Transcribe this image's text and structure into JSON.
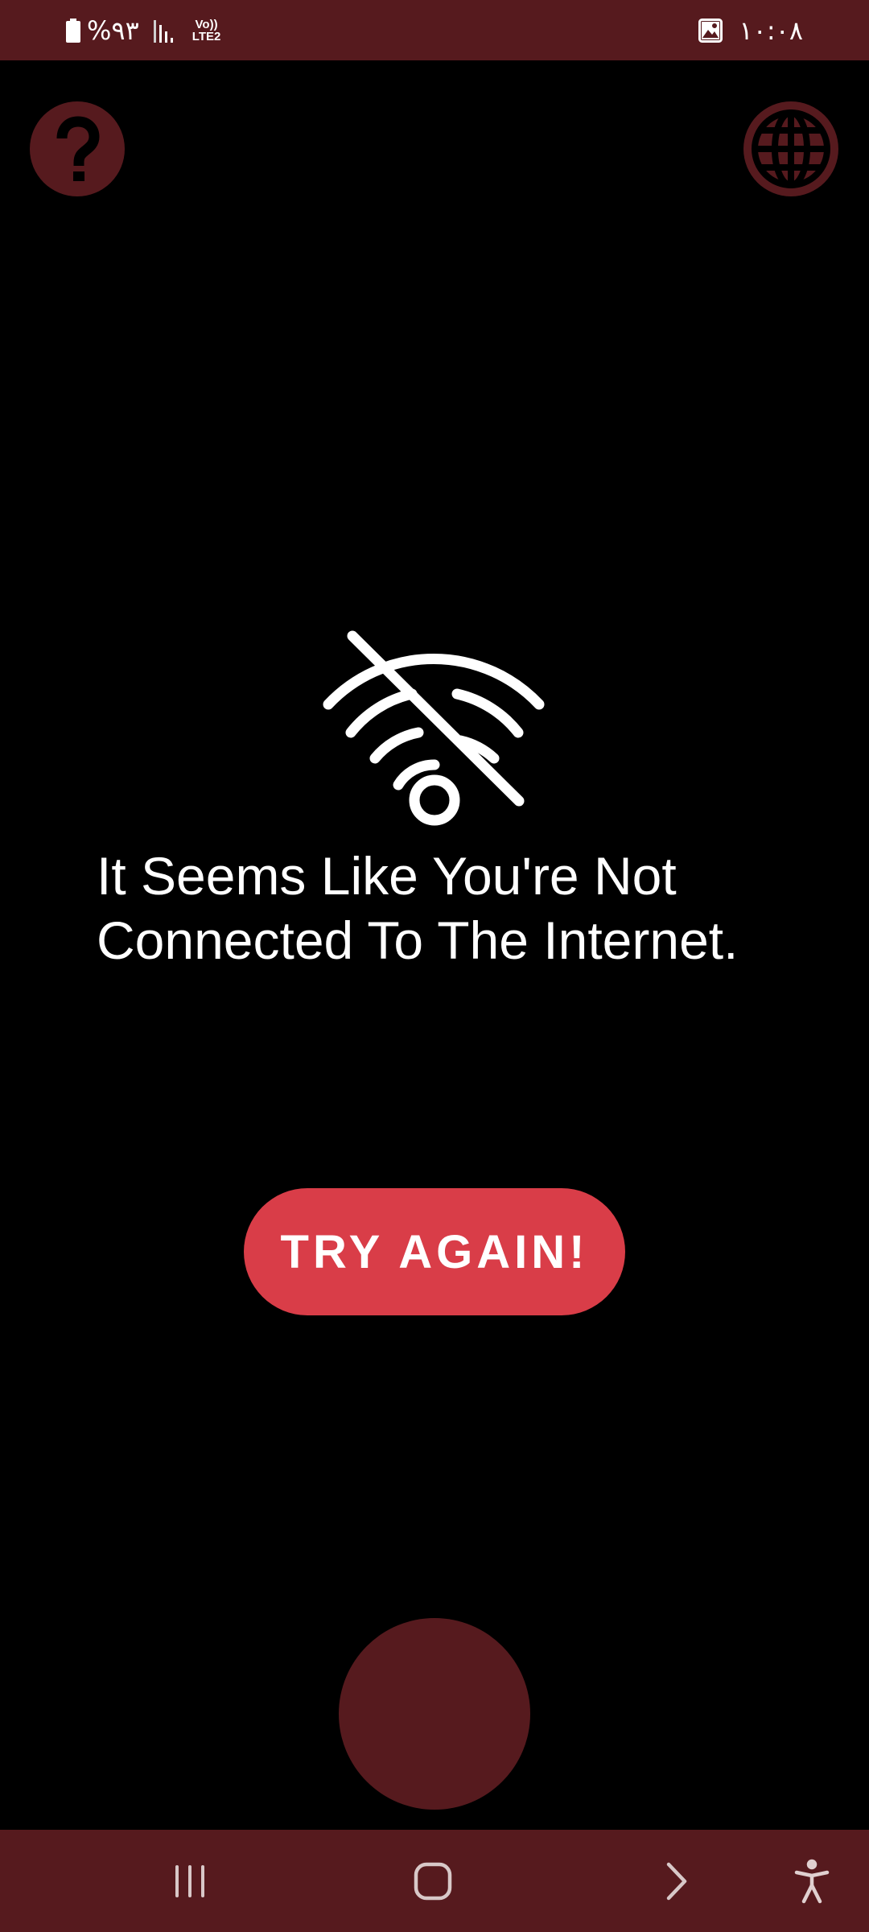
{
  "status_bar": {
    "battery_text": "%٩٣",
    "network_top": "Vo))",
    "network_bottom": "LTE2",
    "time": "١٠:٠٨"
  },
  "icons": {
    "help": "question-mark-icon",
    "language": "globe-icon",
    "no_connection": "wifi-off-icon",
    "nav_recents": "recents-icon",
    "nav_home": "home-icon",
    "nav_back": "back-chevron-icon",
    "nav_accessibility": "accessibility-icon"
  },
  "main": {
    "message": "It Seems Like You're Not\nConnected To The Internet.",
    "try_again_label": "TRY AGAIN!"
  },
  "colors": {
    "background": "#000000",
    "bar_maroon": "#561a1e",
    "button_red": "#d93d48",
    "text": "#ffffff"
  }
}
